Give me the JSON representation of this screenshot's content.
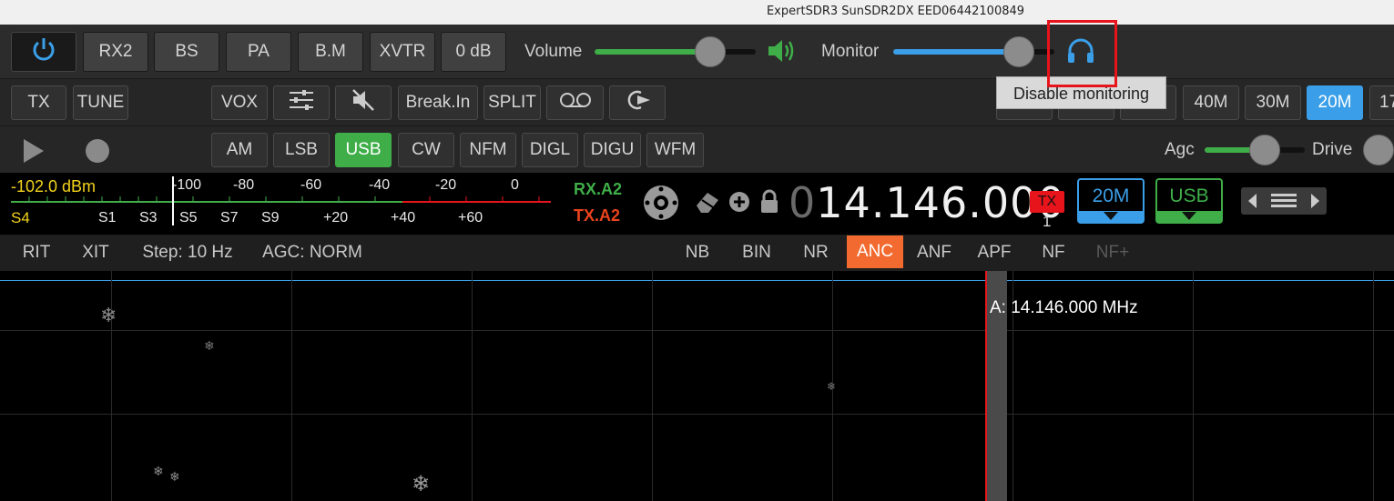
{
  "window": {
    "title": "ExpertSDR3 SunSDR2DX EED06442100849"
  },
  "top": {
    "buttons": [
      "RX2",
      "BS",
      "PA",
      "B.M",
      "XVTR",
      "0 dB"
    ],
    "volume_label": "Volume",
    "monitor_label": "Monitor",
    "volume_level": 0.72,
    "monitor_level": 0.78
  },
  "tooltip": {
    "text": "Disable monitoring"
  },
  "row2": {
    "left": [
      "TX",
      "TUNE"
    ],
    "mid": [
      "VOX",
      "Break.In",
      "SPLIT"
    ],
    "bands": [
      "40M",
      "30M",
      "20M",
      "17"
    ],
    "selected_band": "20M"
  },
  "row3": {
    "modes": [
      "AM",
      "LSB",
      "USB",
      "CW",
      "NFM",
      "DIGL",
      "DIGU",
      "WFM"
    ],
    "selected_mode": "USB",
    "agc_label": "Agc",
    "drive_label": "Drive"
  },
  "meter": {
    "dbm": "-102.0 dBm",
    "s_value": "S4",
    "top_ticks": [
      "-100",
      "-80",
      "-60",
      "-40",
      "-20",
      "0"
    ],
    "bottom_ticks": [
      "S1",
      "S3",
      "S5",
      "S7",
      "S9",
      "+20",
      "+40",
      "+60"
    ]
  },
  "rx_ant": "RX.A2",
  "tx_ant": "TX.A2",
  "freq": {
    "leading": "0",
    "main": "14.146.000"
  },
  "tx_badge": "TX",
  "tx_count": "1",
  "band_box": "20M",
  "mode_box": "USB",
  "dsp": {
    "left": [
      "RIT",
      "XIT",
      "Step: 10 Hz",
      "AGC: NORM"
    ],
    "right": [
      "NB",
      "BIN",
      "NR",
      "ANC",
      "ANF",
      "APF",
      "NF",
      "NF+"
    ],
    "active": "ANC"
  },
  "spectrum": {
    "marker": "A: 14.146.000 MHz"
  },
  "colors": {
    "accent_blue": "#3a9fe8",
    "green": "#3fae49",
    "anc": "#f26a2f",
    "tx_red": "#e8141c"
  }
}
